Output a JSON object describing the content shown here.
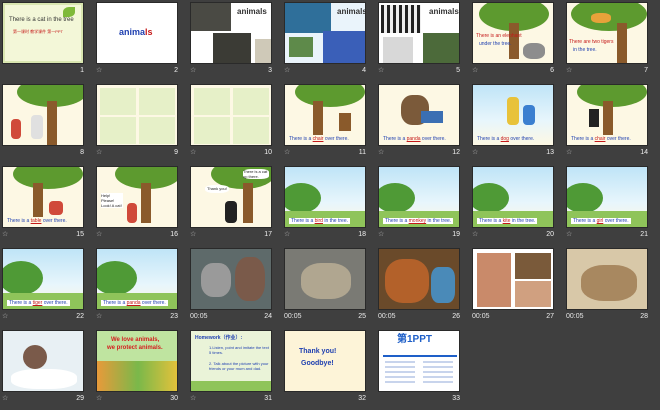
{
  "slides": [
    {
      "num": "1",
      "title": "There is a cat in the tree",
      "sub": "第一课时 教学课件 第一PPT"
    },
    {
      "num": "2",
      "title_part1": "anima",
      "title_part2": "ls"
    },
    {
      "num": "3",
      "title": "animals"
    },
    {
      "num": "4",
      "title": "animals"
    },
    {
      "num": "5",
      "title": "animals"
    },
    {
      "num": "6",
      "line1": "There is an elephant",
      "line2": "under the tree."
    },
    {
      "num": "7",
      "line1": "There are two tigers",
      "line2": "in the tree."
    },
    {
      "num": "8"
    },
    {
      "num": "9"
    },
    {
      "num": "10"
    },
    {
      "num": "11",
      "caption_pre": "There is a",
      "caption_word": "chair",
      "caption_post": "over there."
    },
    {
      "num": "12",
      "caption_pre": "There is a",
      "caption_word": "panda",
      "caption_post": "over there."
    },
    {
      "num": "13",
      "caption_pre": "There is a",
      "caption_word": "dog",
      "caption_post": "over there."
    },
    {
      "num": "14",
      "caption_pre": "There is a",
      "caption_word": "chair",
      "caption_post": "over there."
    },
    {
      "num": "15",
      "caption_pre": "There is a",
      "caption_word": "table",
      "caption_post": "over there."
    },
    {
      "num": "16",
      "bubble": "Help! Please! Look! A cat!"
    },
    {
      "num": "17",
      "bubble1": "There is a cat up there.",
      "bubble2": "Thank you!"
    },
    {
      "num": "18",
      "caption_pre": "There is a",
      "caption_word": "bird",
      "caption_post": "in the tree."
    },
    {
      "num": "19",
      "caption_pre": "There is a",
      "caption_word": "monkey",
      "caption_post": "in the tree."
    },
    {
      "num": "20",
      "caption_pre": "There is a",
      "caption_word": "kite",
      "caption_post": "in the tree."
    },
    {
      "num": "21",
      "caption_pre": "There is a",
      "caption_word": "girl",
      "caption_post": "over there."
    },
    {
      "num": "22",
      "caption_pre": "There is a",
      "caption_word": "tiger",
      "caption_post": "over there."
    },
    {
      "num": "23",
      "caption_pre": "There is a",
      "caption_word": "panda",
      "caption_post": "over there."
    },
    {
      "num": "24",
      "dur": "00:05"
    },
    {
      "num": "25",
      "dur": "00:05"
    },
    {
      "num": "26",
      "dur": "00:05"
    },
    {
      "num": "27",
      "dur": "00:05"
    },
    {
      "num": "28",
      "dur": "00:05"
    },
    {
      "num": "29"
    },
    {
      "num": "30",
      "line1": "We love animals,",
      "line2": "we protect animals."
    },
    {
      "num": "31",
      "title": "Homework（作业）:",
      "item1": "1.Listen, point and imitate the text 5 times.",
      "item2": "2. Talk about the picture with your friends or your mum and dad."
    },
    {
      "num": "32",
      "line1": "Thank you!",
      "line2": "Goodbye!"
    },
    {
      "num": "33",
      "brand": "第1PPT"
    }
  ],
  "star_glyph": "☆"
}
